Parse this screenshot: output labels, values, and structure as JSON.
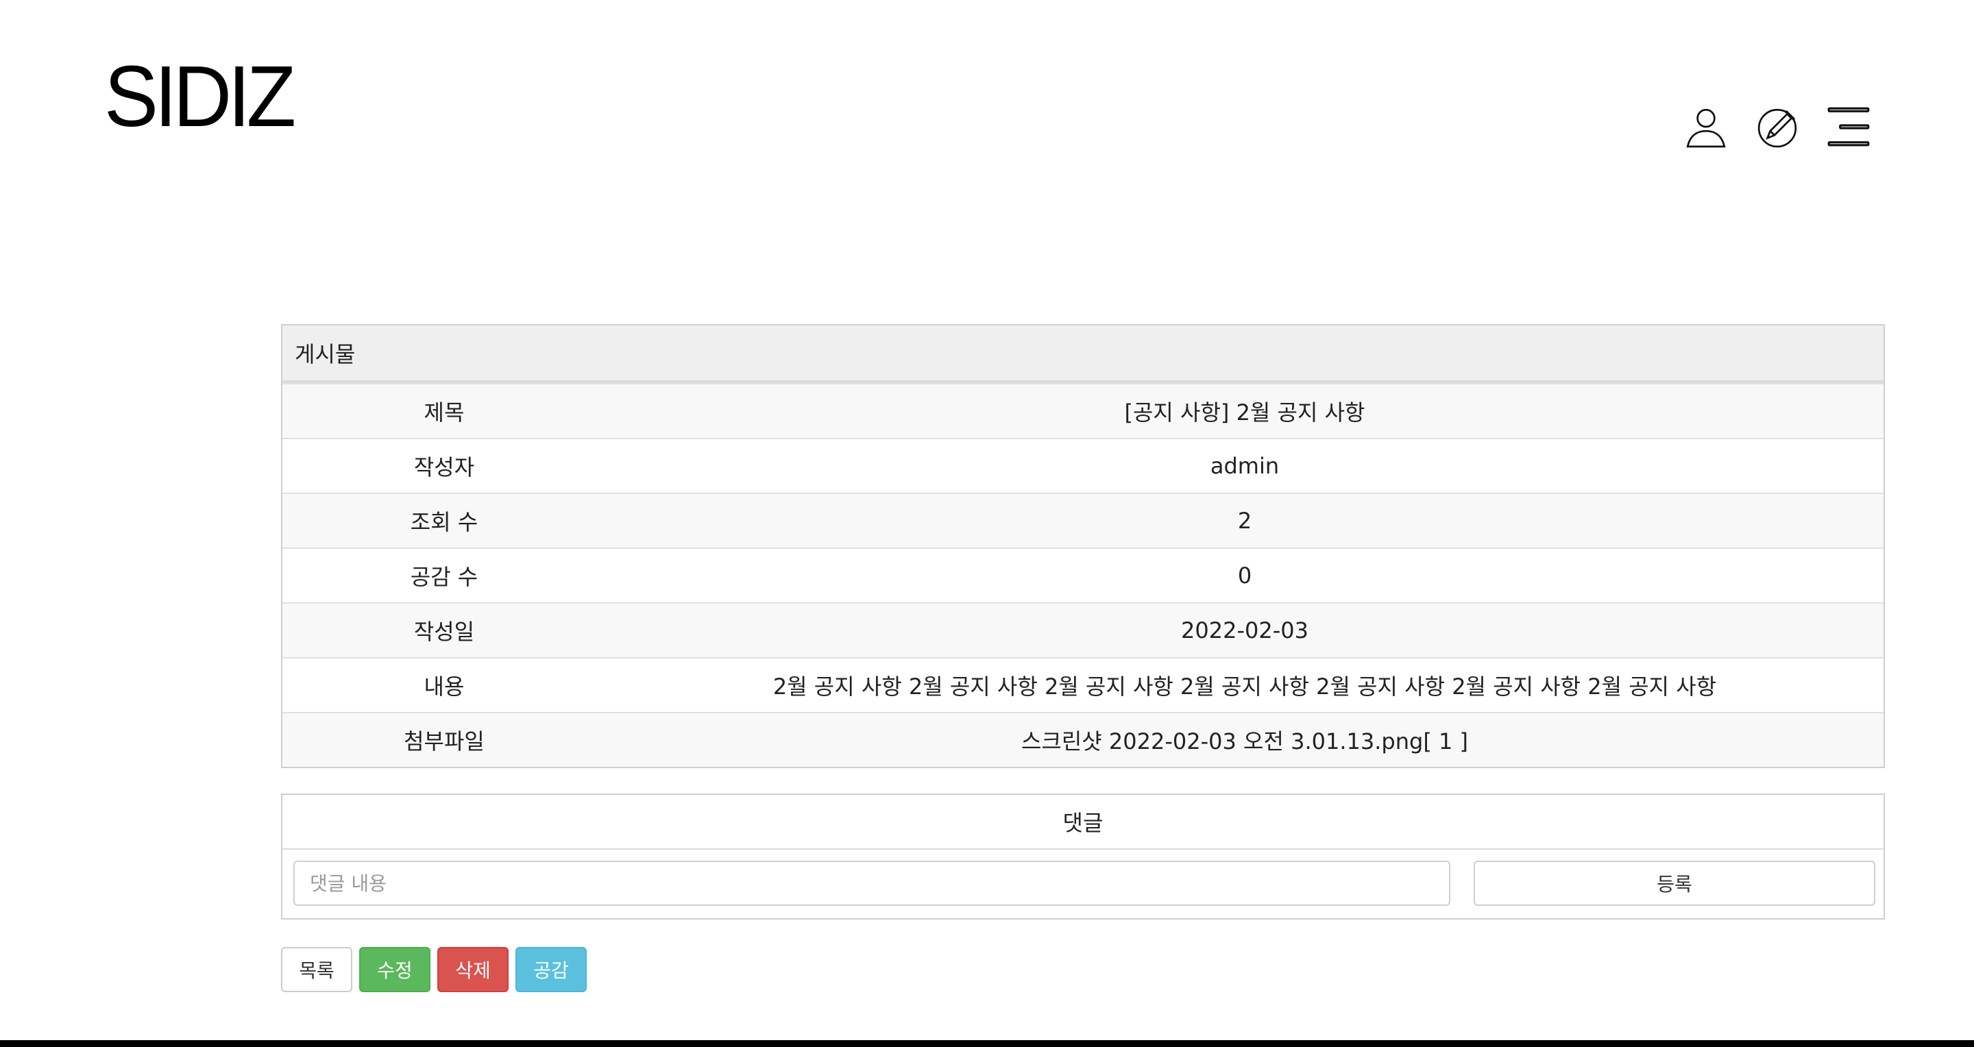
{
  "header": {
    "logo": "SIDIZ",
    "icons": [
      "user-icon",
      "edit-icon",
      "menu-icon"
    ]
  },
  "post": {
    "heading": "게시물",
    "rows": [
      {
        "label": "제목",
        "value": "[공지 사항] 2월 공지 사항"
      },
      {
        "label": "작성자",
        "value": "admin"
      },
      {
        "label": "조회 수",
        "value": "2"
      },
      {
        "label": "공감 수",
        "value": "0"
      },
      {
        "label": "작성일",
        "value": "2022-02-03"
      },
      {
        "label": "내용",
        "value": "2월 공지 사항 2월 공지 사항 2월 공지 사항 2월 공지 사항 2월 공지 사항 2월 공지 사항 2월 공지 사항"
      },
      {
        "label": "첨부파일",
        "value": "스크린샷 2022-02-03 오전 3.01.13.png[ 1 ]"
      }
    ]
  },
  "comment": {
    "title": "댓글",
    "placeholder": "댓글 내용",
    "submit_label": "등록"
  },
  "actions": {
    "list_label": "목록",
    "edit_label": "수정",
    "delete_label": "삭제",
    "like_label": "공감"
  },
  "colors": {
    "edit": "#5cb85c",
    "delete": "#d9534f",
    "like": "#5bc0de",
    "header_bg": "#efefef"
  }
}
